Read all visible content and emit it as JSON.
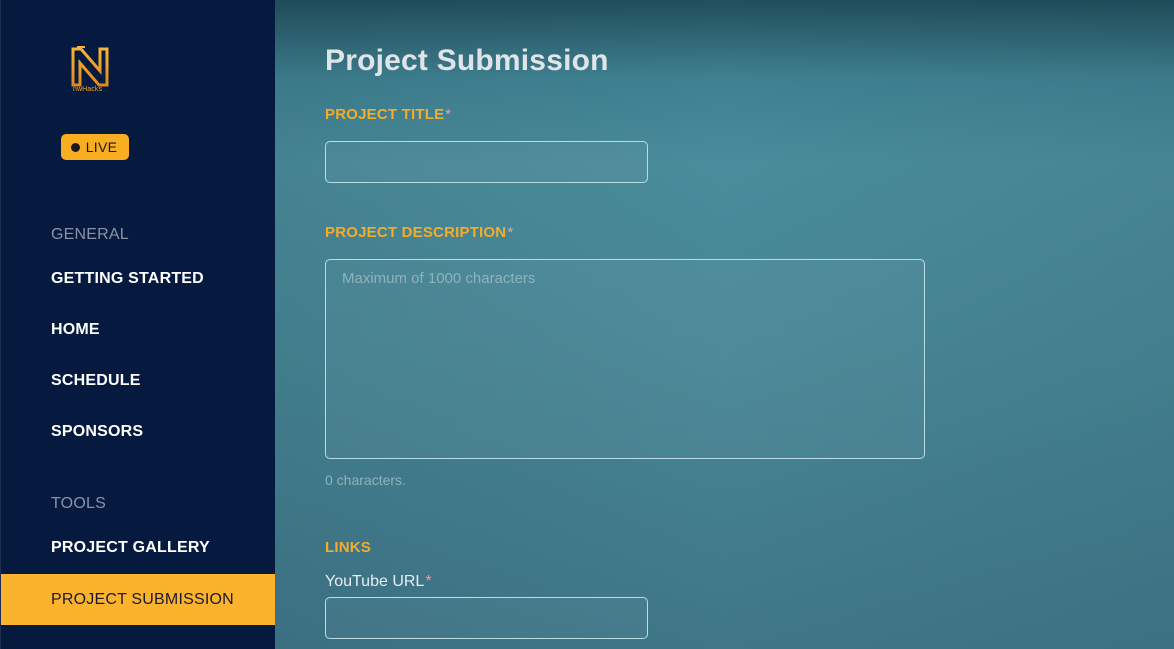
{
  "sidebar": {
    "logo_text": "nwHacks",
    "live_label": "LIVE",
    "sections": [
      {
        "heading": "GENERAL",
        "items": [
          "GETTING STARTED",
          "HOME",
          "SCHEDULE",
          "SPONSORS"
        ]
      },
      {
        "heading": "TOOLS",
        "items": [
          "PROJECT GALLERY",
          "PROJECT SUBMISSION"
        ]
      }
    ],
    "active_item": "PROJECT SUBMISSION"
  },
  "main": {
    "title": "Project Submission",
    "project_title": {
      "label": "PROJECT TITLE",
      "required_mark": "*",
      "value": ""
    },
    "project_description": {
      "label": "PROJECT DESCRIPTION",
      "required_mark": "*",
      "placeholder": "Maximum of 1000 characters",
      "value": "",
      "char_count": "0 characters."
    },
    "links": {
      "heading": "LINKS",
      "youtube_label": "YouTube URL",
      "required_mark": "*",
      "youtube_value": ""
    }
  },
  "colors": {
    "sidebar_bg": "#061a3f",
    "accent": "#f9ad21",
    "field_label": "#f5ac2b",
    "main_bg": "#468594"
  }
}
